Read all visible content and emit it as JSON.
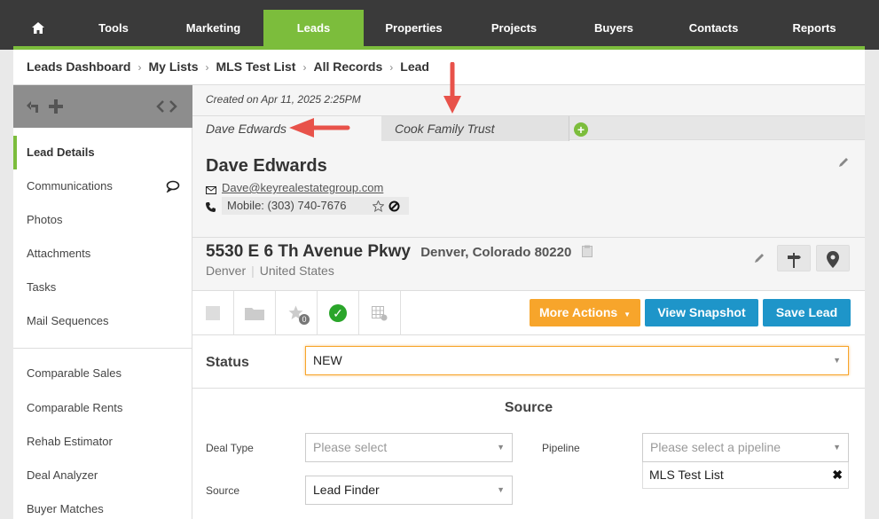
{
  "nav": {
    "home_icon": "home-icon",
    "items": [
      {
        "label": "Tools"
      },
      {
        "label": "Marketing"
      },
      {
        "label": "Leads"
      },
      {
        "label": "Properties"
      },
      {
        "label": "Projects"
      },
      {
        "label": "Buyers"
      },
      {
        "label": "Contacts"
      },
      {
        "label": "Reports"
      }
    ],
    "active": "Leads",
    "accent_color": "#7cbd3c"
  },
  "breadcrumb": [
    "Leads Dashboard",
    "My Lists",
    "MLS Test List",
    "All Records",
    "Lead"
  ],
  "sidebar": {
    "items": [
      {
        "label": "Lead Details"
      },
      {
        "label": "Communications"
      },
      {
        "label": "Photos"
      },
      {
        "label": "Attachments"
      },
      {
        "label": "Tasks"
      },
      {
        "label": "Mail Sequences"
      },
      {
        "label": "Comparable Sales"
      },
      {
        "label": "Comparable Rents"
      },
      {
        "label": "Rehab Estimator"
      },
      {
        "label": "Deal Analyzer"
      },
      {
        "label": "Buyer Matches"
      }
    ]
  },
  "main": {
    "created": "Created on Apr 11, 2025 2:25PM",
    "tabs": [
      {
        "label": "Dave Edwards"
      },
      {
        "label": "Cook Family Trust"
      }
    ],
    "contact": {
      "name": "Dave Edwards",
      "email": "Dave@keyrealestategroup.com",
      "phone": "Mobile: (303) 740-7676"
    },
    "address": {
      "street": "5530 E 6 Th Avenue Pkwy",
      "city_state_zip": "Denver, Colorado 80220",
      "city": "Denver",
      "country": "United States"
    },
    "actions": {
      "favorites_count": "0",
      "more_actions": "More Actions",
      "view_snapshot": "View Snapshot",
      "save_lead": "Save Lead"
    },
    "status": {
      "label": "Status",
      "value": "NEW"
    },
    "source": {
      "title": "Source",
      "deal_type_label": "Deal Type",
      "deal_type_placeholder": "Please select",
      "pipeline_label": "Pipeline",
      "pipeline_placeholder": "Please select a pipeline",
      "pipeline_selected": "MLS Test List",
      "source_label": "Source",
      "source_value": "Lead Finder"
    }
  }
}
